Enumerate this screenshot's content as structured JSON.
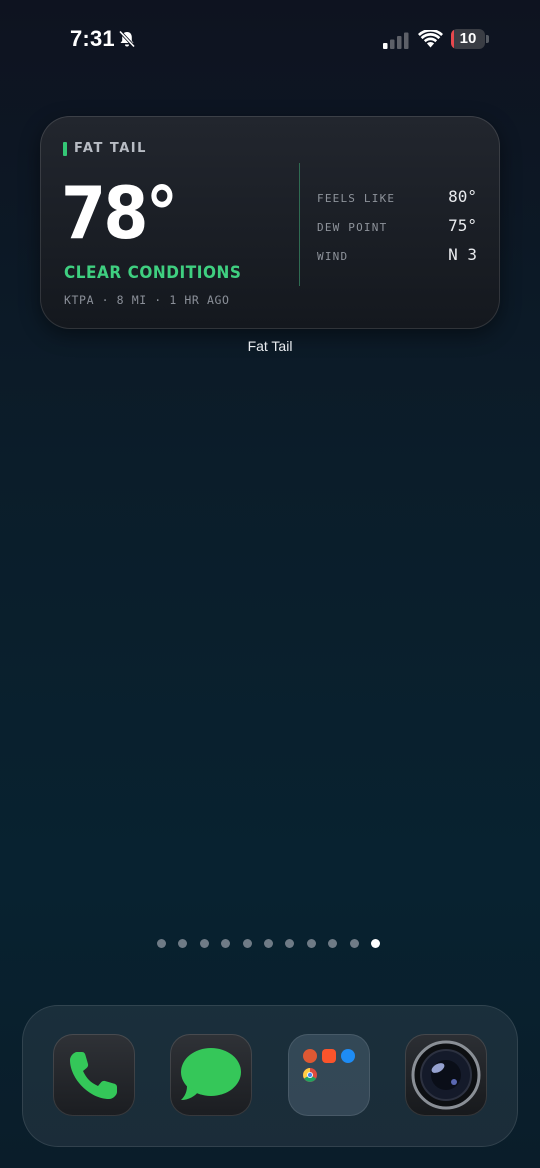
{
  "status_bar": {
    "time": "7:31",
    "battery_level": "10",
    "battery_fraction": 0.1
  },
  "widget": {
    "title": "FAT TAIL",
    "temperature": "78°",
    "condition": "CLEAR CONDITIONS",
    "meta": "KTPA · 8 MI · 1 HR AGO",
    "stats": [
      {
        "label": "FEELS LIKE",
        "value": "80°"
      },
      {
        "label": "DEW POINT",
        "value": "75°"
      },
      {
        "label": "WIND",
        "value": "N 3"
      }
    ],
    "app_label": "Fat Tail",
    "accent_color": "#34c776"
  },
  "page_indicator": {
    "count": 11,
    "active_index": 10
  },
  "dock": {
    "apps": [
      {
        "icon": "phone-icon"
      },
      {
        "icon": "messages-icon"
      },
      {
        "icon": "folder-icon",
        "contents": [
          "duckduckgo-icon",
          "brave-icon",
          "safari-icon",
          "chrome-icon"
        ]
      },
      {
        "icon": "camera-icon"
      }
    ]
  }
}
